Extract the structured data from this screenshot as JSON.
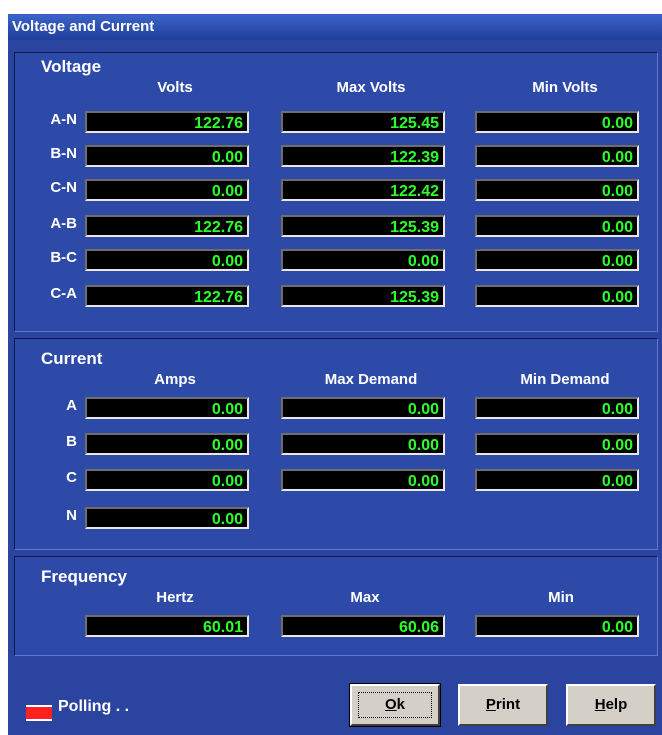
{
  "window": {
    "title": "Voltage and Current"
  },
  "voltage": {
    "title": "Voltage",
    "columns": [
      "Volts",
      "Max Volts",
      "Min Volts"
    ],
    "rows": [
      {
        "label": "A-N",
        "values": [
          "122.76",
          "125.45",
          "0.00"
        ]
      },
      {
        "label": "B-N",
        "values": [
          "0.00",
          "122.39",
          "0.00"
        ]
      },
      {
        "label": "C-N",
        "values": [
          "0.00",
          "122.42",
          "0.00"
        ]
      },
      {
        "label": "A-B",
        "values": [
          "122.76",
          "125.39",
          "0.00"
        ]
      },
      {
        "label": "B-C",
        "values": [
          "0.00",
          "0.00",
          "0.00"
        ]
      },
      {
        "label": "C-A",
        "values": [
          "122.76",
          "125.39",
          "0.00"
        ]
      }
    ]
  },
  "current": {
    "title": "Current",
    "columns": [
      "Amps",
      "Max Demand",
      "Min Demand"
    ],
    "rows": [
      {
        "label": "A",
        "values": [
          "0.00",
          "0.00",
          "0.00"
        ]
      },
      {
        "label": "B",
        "values": [
          "0.00",
          "0.00",
          "0.00"
        ]
      },
      {
        "label": "C",
        "values": [
          "0.00",
          "0.00",
          "0.00"
        ]
      },
      {
        "label": "N",
        "values": [
          "0.00"
        ]
      }
    ]
  },
  "frequency": {
    "title": "Frequency",
    "columns": [
      "Hertz",
      "Max",
      "Min"
    ],
    "values": [
      "60.01",
      "60.06",
      "0.00"
    ]
  },
  "status": {
    "text": "Polling . .",
    "indicator_color": "#ff2020"
  },
  "buttons": {
    "ok": {
      "mnemonic": "O",
      "rest": "k"
    },
    "print": {
      "mnemonic": "P",
      "rest": "rint"
    },
    "help": {
      "mnemonic": "H",
      "rest": "elp"
    }
  },
  "colors": {
    "panel": "#2e4aa8",
    "readout_text": "#2cff2c",
    "readout_bg": "#000000"
  }
}
